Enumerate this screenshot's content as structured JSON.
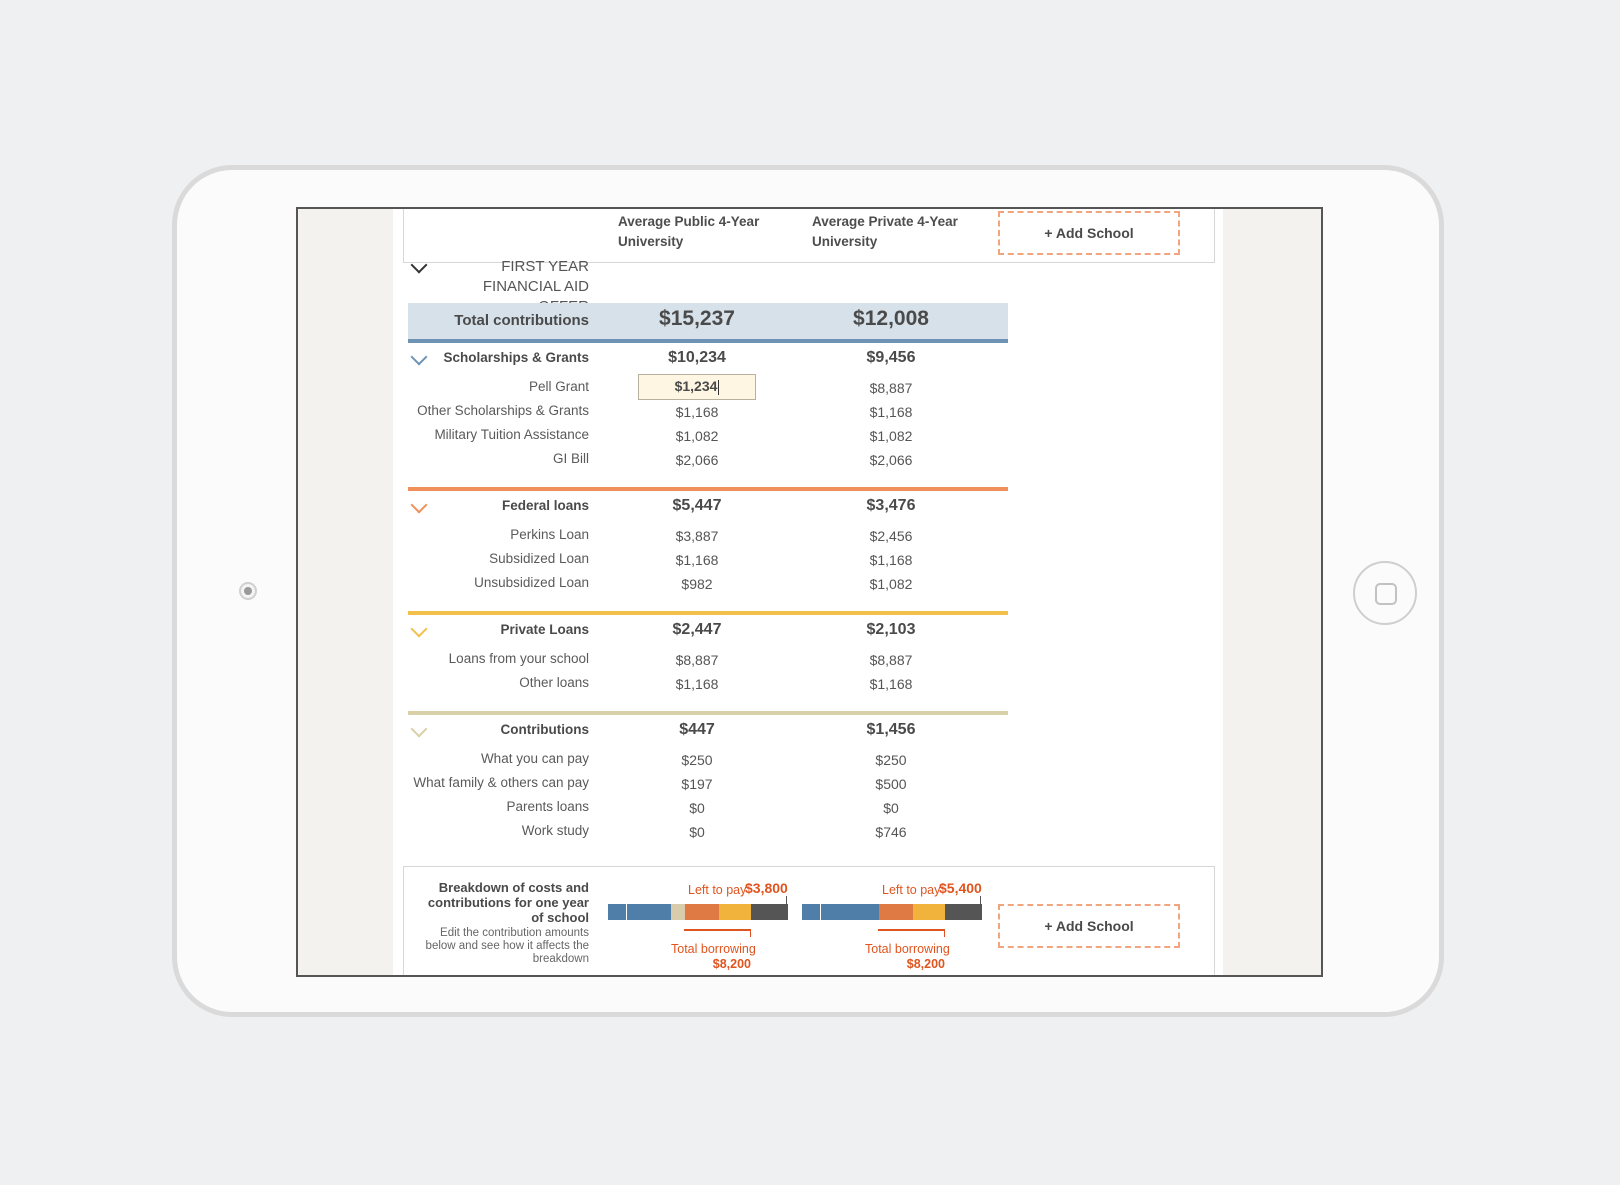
{
  "header": {
    "col1": "Average Public 4-Year University",
    "col2": "Average Private 4-Year University",
    "add_school": "+ Add School"
  },
  "section_title": "FIRST YEAR FINANCIAL AID OFFER",
  "total": {
    "label": "Total contributions",
    "col1": "$15,237",
    "col2": "$12,008"
  },
  "groups": [
    {
      "name": "Scholarships & Grants",
      "color": "#6f93b5",
      "col1": "$10,234",
      "col2": "$9,456",
      "rows": [
        {
          "label": "Pell Grant",
          "col1": "$1,234",
          "col2": "$8,887"
        },
        {
          "label": "Other Scholarships & Grants",
          "col1": "$1,168",
          "col2": "$1,168"
        },
        {
          "label": "Military Tuition Assistance",
          "col1": "$1,082",
          "col2": "$1,082"
        },
        {
          "label": "GI Bill",
          "col1": "$2,066",
          "col2": "$2,066"
        }
      ]
    },
    {
      "name": "Federal loans",
      "color": "#f0905a",
      "col1": "$5,447",
      "col2": "$3,476",
      "rows": [
        {
          "label": "Perkins Loan",
          "col1": "$3,887",
          "col2": "$2,456"
        },
        {
          "label": "Subsidized Loan",
          "col1": "$1,168",
          "col2": "$1,168"
        },
        {
          "label": "Unsubsidized Loan",
          "col1": "$982",
          "col2": "$1,082"
        }
      ]
    },
    {
      "name": "Private Loans",
      "color": "#f3c04c",
      "col1": "$2,447",
      "col2": "$2,103",
      "rows": [
        {
          "label": "Loans from your school",
          "col1": "$8,887",
          "col2": "$8,887"
        },
        {
          "label": "Other loans",
          "col1": "$1,168",
          "col2": "$1,168"
        }
      ]
    },
    {
      "name": "Contributions",
      "color": "#d8d0a8",
      "col1": "$447",
      "col2": "$1,456",
      "rows": [
        {
          "label": "What you can pay",
          "col1": "$250",
          "col2": "$250"
        },
        {
          "label": "What family & others can pay",
          "col1": "$197",
          "col2": "$500"
        },
        {
          "label": "Parents loans",
          "col1": "$0",
          "col2": "$0"
        },
        {
          "label": "Work study",
          "col1": "$0",
          "col2": "$746"
        }
      ]
    }
  ],
  "breakdown": {
    "title": "Breakdown of costs and contributions for one year of school",
    "subtitle": "Edit the contribution amounts below and see how it affects the breakdown",
    "left_to_pay_label": "Left to pay",
    "col1_left": "$3,800",
    "col2_left": "$5,400",
    "total_borrowing_label": "Total borrowing",
    "col1_borrowing": "$8,200",
    "col2_borrowing": "$8,200",
    "add_school": "+ Add School"
  },
  "colors": {
    "blue": "#4f7ea8",
    "orange": "#e07a45",
    "yellow": "#f2b33d",
    "tan": "#d8ccaa",
    "dark": "#555555",
    "accent": "#e0541f"
  }
}
